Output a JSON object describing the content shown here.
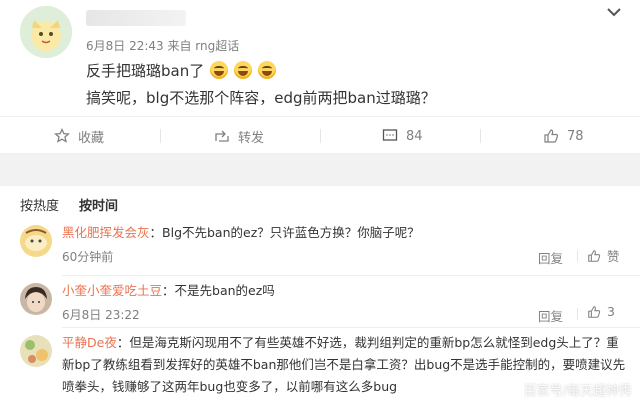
{
  "post": {
    "meta": "6月8日 22:43 来自 rng超话",
    "line1": "反手把璐璐ban了",
    "line2": "搞笑呢，blg不选那个阵容，edg前两把ban过璐璐？",
    "emoji_count": 3
  },
  "actions": {
    "favorite": "收藏",
    "forward": "转发",
    "comment_count": "84",
    "like_count": "78"
  },
  "sort": {
    "hot": "按热度",
    "time": "按时间"
  },
  "comments": [
    {
      "user": "黑化肥挥发会灰",
      "text": "：Blg不先ban的ez？只许蓝色方换？你脑子呢？",
      "time": "60分钟前",
      "reply": "回复",
      "likes": "赞"
    },
    {
      "user": "小奎小奎爱吃土豆",
      "text": "：不是先ban的ez吗",
      "time": "6月8日 23:22",
      "reply": "回复",
      "likes": "3"
    },
    {
      "user": "平静De夜",
      "text": "：但是海克斯闪现用不了有些英雄不好选，裁判组判定的重新bp怎么就怪到edg头上了？重新bp了教练组看到发挥好的英雄不ban那他们岂不是白拿工资？出bug不是选手能控制的，要喷建议先喷拳头，钱赚够了这两年bug也变多了，以前哪有这么多bug"
    }
  ],
  "watermark": "百家号/每天超神秀",
  "colors": {
    "username": "#eb7350",
    "meta": "#808080",
    "text": "#333333",
    "background_gap": "#f2f2f2"
  },
  "icons": {
    "menu": "chevron-down-icon",
    "favorite": "star-icon",
    "forward": "share-icon",
    "comment": "comment-icon",
    "like": "thumbs-up-icon"
  }
}
